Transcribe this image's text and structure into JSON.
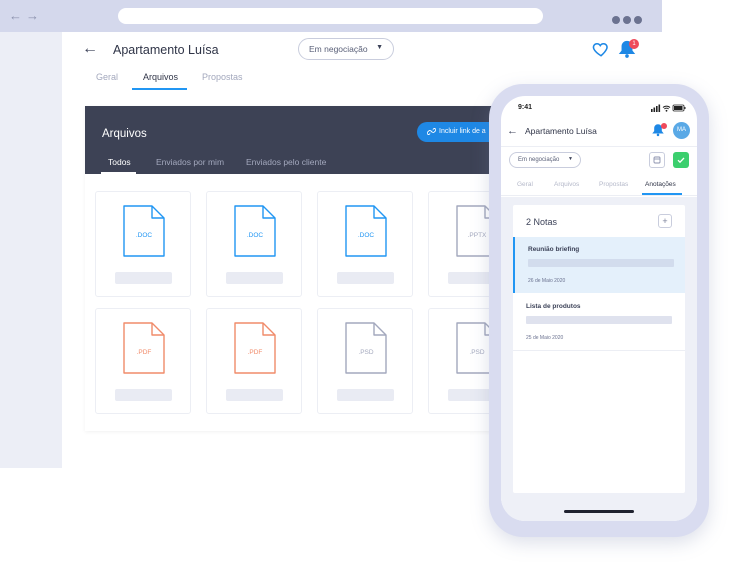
{
  "desktop": {
    "nav": {
      "back_glyph": "←",
      "forward_glyph": "→"
    },
    "header": {
      "back_glyph": "←",
      "title": "Apartamento Luísa",
      "status": "Em negociação",
      "caret": "▼",
      "bell_badge": "1"
    },
    "tabs": [
      "Geral",
      "Arquivos",
      "Propostas"
    ],
    "panel": {
      "title": "Arquivos",
      "link_button": "Incluir link de a",
      "sub_tabs": [
        "Todos",
        "Enviados por mim",
        "Enviados pelo cliente"
      ],
      "files": [
        {
          "ext": ".DOC",
          "color": "#2196f3"
        },
        {
          "ext": ".DOC",
          "color": "#2196f3"
        },
        {
          "ext": ".DOC",
          "color": "#2196f3"
        },
        {
          "ext": ".PPTX",
          "color": "#a3a8bd"
        },
        {
          "ext": ".PDF",
          "color": "#f08b6a"
        },
        {
          "ext": ".PDF",
          "color": "#f08b6a"
        },
        {
          "ext": ".PSD",
          "color": "#a3a8bd"
        },
        {
          "ext": ".PSD",
          "color": "#a3a8bd"
        }
      ]
    }
  },
  "phone": {
    "time": "9:41",
    "back_glyph": "←",
    "title": "Apartamento Luísa",
    "avatar": "MA",
    "status": "Em negociação",
    "caret": "▼",
    "tabs": [
      "Geral",
      "Arquivos",
      "Propostas",
      "Anotações"
    ],
    "notes_title": "2 Notas",
    "add_glyph": "+",
    "notes": [
      {
        "title": "Reunião briefing",
        "date": "26 de Maio 2020"
      },
      {
        "title": "Lista de produtos",
        "date": "25 de Maio 2020"
      }
    ]
  },
  "colors": {
    "accent": "#2196f3",
    "panel_header": "#3d4255",
    "success": "#3ccf6e",
    "badge": "#ef4a5b"
  }
}
